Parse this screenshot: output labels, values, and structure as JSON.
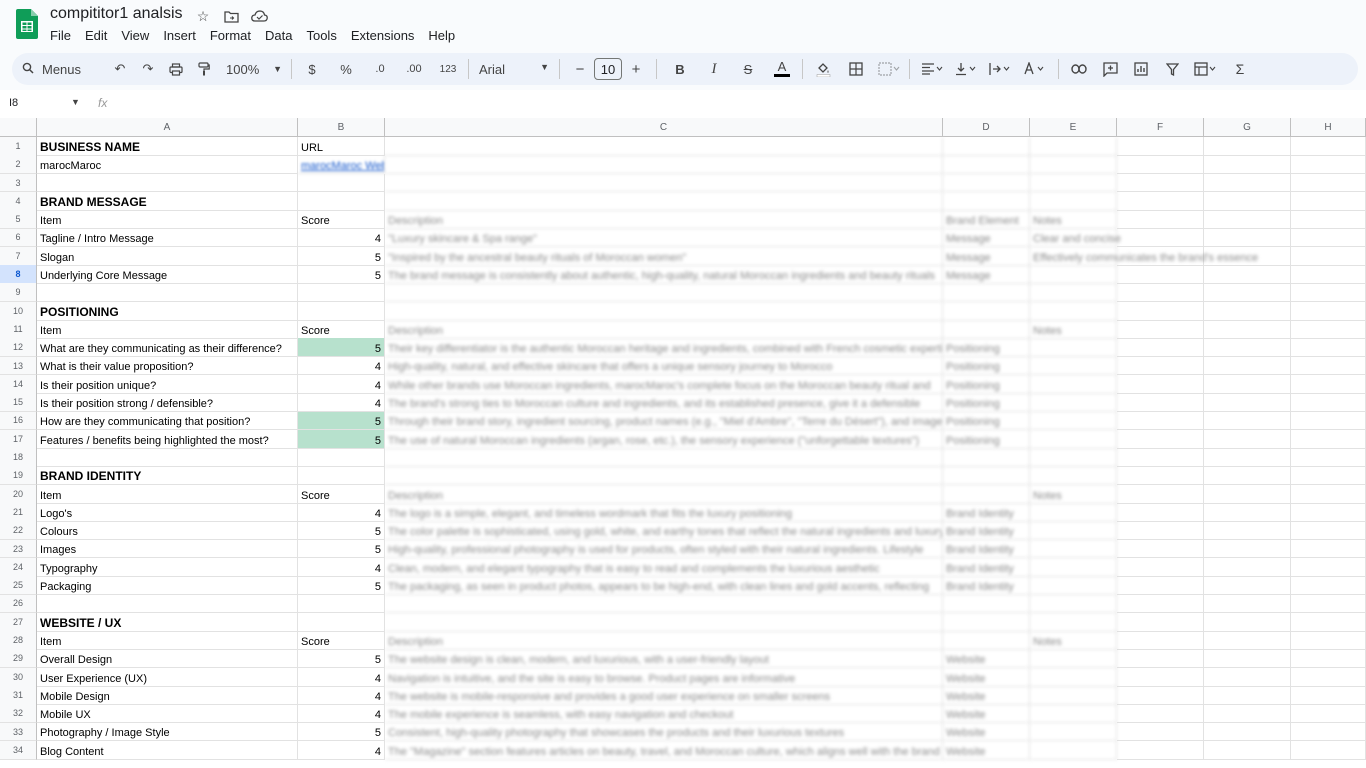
{
  "app": {
    "title": "compititor1 analsis",
    "menus": [
      "File",
      "Edit",
      "View",
      "Insert",
      "Format",
      "Data",
      "Tools",
      "Extensions",
      "Help"
    ]
  },
  "toolbar": {
    "search_label": "Menus",
    "zoom": "100%",
    "currency": "$",
    "percent": "%",
    "dec_decrease": ".0",
    "dec_increase": ".00",
    "number_format": "123",
    "font": "Arial",
    "font_size": "10",
    "bold": "B",
    "italic": "I",
    "sum": "Σ"
  },
  "formula_bar": {
    "name_box": "I8",
    "fx": "fx",
    "value": ""
  },
  "columns": [
    "A",
    "B",
    "C",
    "D",
    "E",
    "F",
    "G",
    "H"
  ],
  "rows": [
    {
      "n": "1",
      "a": "BUSINESS NAME",
      "b": "URL",
      "c": "",
      "d": "",
      "e": "",
      "style": "bold"
    },
    {
      "n": "2",
      "a": "marocMaroc",
      "b": "marocMaroc Web",
      "c": "",
      "d": "",
      "e": "",
      "style": "link"
    },
    {
      "n": "3",
      "a": "",
      "b": "",
      "c": "",
      "d": "",
      "e": ""
    },
    {
      "n": "4",
      "a": "BRAND MESSAGE",
      "b": "",
      "c": "",
      "d": "",
      "e": "",
      "style": "bold"
    },
    {
      "n": "5",
      "a": "Item",
      "b": "Score",
      "c": "Description",
      "d": "Brand Element",
      "e": "Notes"
    },
    {
      "n": "6",
      "a": "Tagline / Intro Message",
      "b": "4",
      "c": "\"Luxury skincare & Spa range\"",
      "d": "Message",
      "e": "Clear and concise"
    },
    {
      "n": "7",
      "a": "Slogan",
      "b": "5",
      "c": "\"Inspired by the ancestral beauty rituals of Moroccan women\"",
      "d": "Message",
      "e": "Effectively communicates the brand's essence"
    },
    {
      "n": "8",
      "a": "Underlying Core Message",
      "b": "5",
      "c": "The brand message is consistently about authentic, high-quality, natural Moroccan ingredients and beauty rituals",
      "d": "Message",
      "e": ""
    },
    {
      "n": "9",
      "a": "",
      "b": "",
      "c": "",
      "d": "",
      "e": ""
    },
    {
      "n": "10",
      "a": "POSITIONING",
      "b": "",
      "c": "",
      "d": "",
      "e": "",
      "style": "bold"
    },
    {
      "n": "11",
      "a": "Item",
      "b": "Score",
      "c": "Description",
      "d": "",
      "e": "Notes"
    },
    {
      "n": "12",
      "a": "What are they communicating as their difference?",
      "b": "5",
      "c": "Their key differentiator is the authentic Moroccan heritage and ingredients, combined with French cosmetic expertise",
      "d": "Positioning",
      "e": "",
      "green": true
    },
    {
      "n": "13",
      "a": "What is their value proposition?",
      "b": "4",
      "c": "High-quality, natural, and effective skincare that offers a unique sensory journey to Morocco",
      "d": "Positioning",
      "e": ""
    },
    {
      "n": "14",
      "a": "Is their position unique?",
      "b": "4",
      "c": "While other brands use Moroccan ingredients, marocMaroc's complete focus on the Moroccan beauty ritual and",
      "d": "Positioning",
      "e": ""
    },
    {
      "n": "15",
      "a": "Is their position strong / defensible?",
      "b": "4",
      "c": "The brand's strong ties to Moroccan culture and ingredients, and its established presence, give it a defensible",
      "d": "Positioning",
      "e": ""
    },
    {
      "n": "16",
      "a": "How are they communicating that position?",
      "b": "5",
      "c": "Through their brand story, ingredient sourcing, product names (e.g., \"Miel d'Ambre\", \"Terre du Désert\"), and imagery",
      "d": "Positioning",
      "e": "",
      "green": true
    },
    {
      "n": "17",
      "a": "Features / benefits being highlighted the most?",
      "b": "5",
      "c": "The use of natural Moroccan ingredients (argan, rose, etc.), the sensory experience (\"unforgettable textures\")",
      "d": "Positioning",
      "e": "",
      "green": true
    },
    {
      "n": "18",
      "a": "",
      "b": "",
      "c": "",
      "d": "",
      "e": ""
    },
    {
      "n": "19",
      "a": "BRAND IDENTITY",
      "b": "",
      "c": "",
      "d": "",
      "e": "",
      "style": "bold"
    },
    {
      "n": "20",
      "a": "Item",
      "b": "Score",
      "c": "Description",
      "d": "",
      "e": "Notes"
    },
    {
      "n": "21",
      "a": "Logo's",
      "b": "4",
      "c": "The logo is a simple, elegant, and timeless wordmark that fits the luxury positioning",
      "d": "Brand Identity",
      "e": ""
    },
    {
      "n": "22",
      "a": "Colours",
      "b": "5",
      "c": "The color palette is sophisticated, using gold, white, and earthy tones that reflect the natural ingredients and luxury",
      "d": "Brand Identity",
      "e": ""
    },
    {
      "n": "23",
      "a": "Images",
      "b": "5",
      "c": "High-quality, professional photography is used for products, often styled with their natural ingredients. Lifestyle",
      "d": "Brand Identity",
      "e": ""
    },
    {
      "n": "24",
      "a": "Typography",
      "b": "4",
      "c": "Clean, modern, and elegant typography that is easy to read and complements the luxurious aesthetic",
      "d": "Brand Identity",
      "e": ""
    },
    {
      "n": "25",
      "a": "Packaging",
      "b": "5",
      "c": "The packaging, as seen in product photos, appears to be high-end, with clean lines and gold accents, reflecting",
      "d": "Brand Identity",
      "e": ""
    },
    {
      "n": "26",
      "a": "",
      "b": "",
      "c": "",
      "d": "",
      "e": ""
    },
    {
      "n": "27",
      "a": "WEBSITE / UX",
      "b": "",
      "c": "",
      "d": "",
      "e": "",
      "style": "bold"
    },
    {
      "n": "28",
      "a": "Item",
      "b": "Score",
      "c": "Description",
      "d": "",
      "e": "Notes"
    },
    {
      "n": "29",
      "a": "Overall Design",
      "b": "5",
      "c": "The website design is clean, modern, and luxurious, with a user-friendly layout",
      "d": "Website",
      "e": ""
    },
    {
      "n": "30",
      "a": "User Experience (UX)",
      "b": "4",
      "c": "Navigation is intuitive, and the site is easy to browse. Product pages are informative",
      "d": "Website",
      "e": ""
    },
    {
      "n": "31",
      "a": "Mobile Design",
      "b": "4",
      "c": "The website is mobile-responsive and provides a good user experience on smaller screens",
      "d": "Website",
      "e": ""
    },
    {
      "n": "32",
      "a": "Mobile UX",
      "b": "4",
      "c": "The mobile experience is seamless, with easy navigation and checkout",
      "d": "Website",
      "e": ""
    },
    {
      "n": "33",
      "a": "Photography / Image Style",
      "b": "5",
      "c": "Consistent, high-quality photography that showcases the products and their luxurious textures",
      "d": "Website",
      "e": ""
    },
    {
      "n": "34",
      "a": "Blog Content",
      "b": "4",
      "c": "The \"Magazine\" section features articles on beauty, travel, and Moroccan culture, which aligns well with the brand",
      "d": "Website",
      "e": ""
    }
  ],
  "colors": {
    "green_fill": "#b7e1cd",
    "selection": "#1a73e8"
  }
}
